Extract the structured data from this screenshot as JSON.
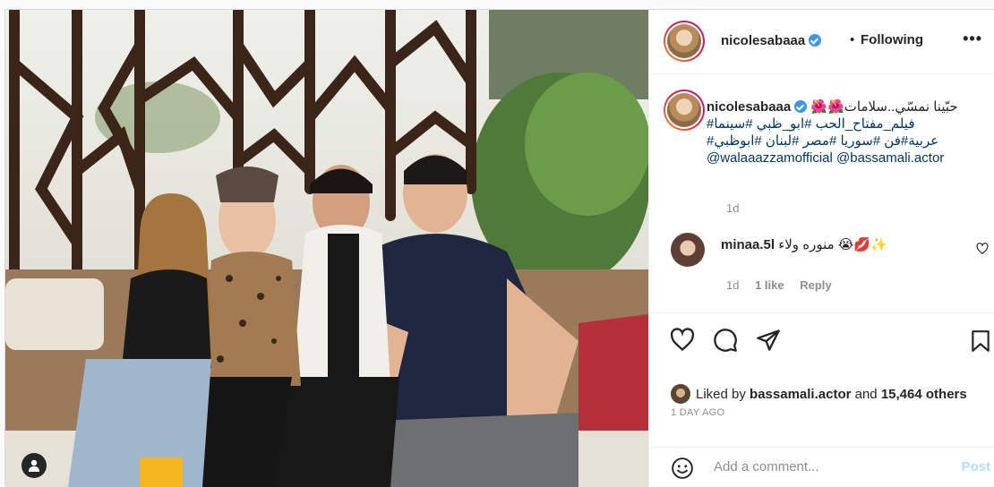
{
  "colors": {
    "accent": "#3897f0",
    "post_disabled": "#b2dffc",
    "muted": "#8e8e8e",
    "link": "#00376b"
  },
  "header": {
    "username": "nicolesabaaa",
    "separator": "•",
    "follow_label": "Following",
    "more_label": "•••"
  },
  "caption": {
    "username": "nicolesabaaa",
    "line1": "🌺🌺حبّينا نمسّي..سلامات",
    "line2": "فيلم_مفتاح_الحب #ابو_ظبي #سينما#",
    "line3": "عربية#فن #سوريا #مصر #لبنان #ابوظبي#",
    "mentions": "@walaaazzamofficial @bassamali.actor",
    "age": "1d"
  },
  "comment": {
    "username": "minaa.5l",
    "text": "منوره ولاء 😭💋✨",
    "age": "1d",
    "likes": "1 like",
    "reply_label": "Reply"
  },
  "likes": {
    "prefix": "Liked by",
    "user": "bassamali.actor",
    "middle": "and",
    "others": "15,464 others"
  },
  "date_label": "1 DAY AGO",
  "add_comment": {
    "placeholder": "Add a comment...",
    "post_label": "Post"
  },
  "icons": [
    "user-tag-icon",
    "heart-icon",
    "comment-icon",
    "share-icon",
    "bookmark-icon",
    "emoji-icon",
    "verified-icon",
    "more-icon"
  ]
}
